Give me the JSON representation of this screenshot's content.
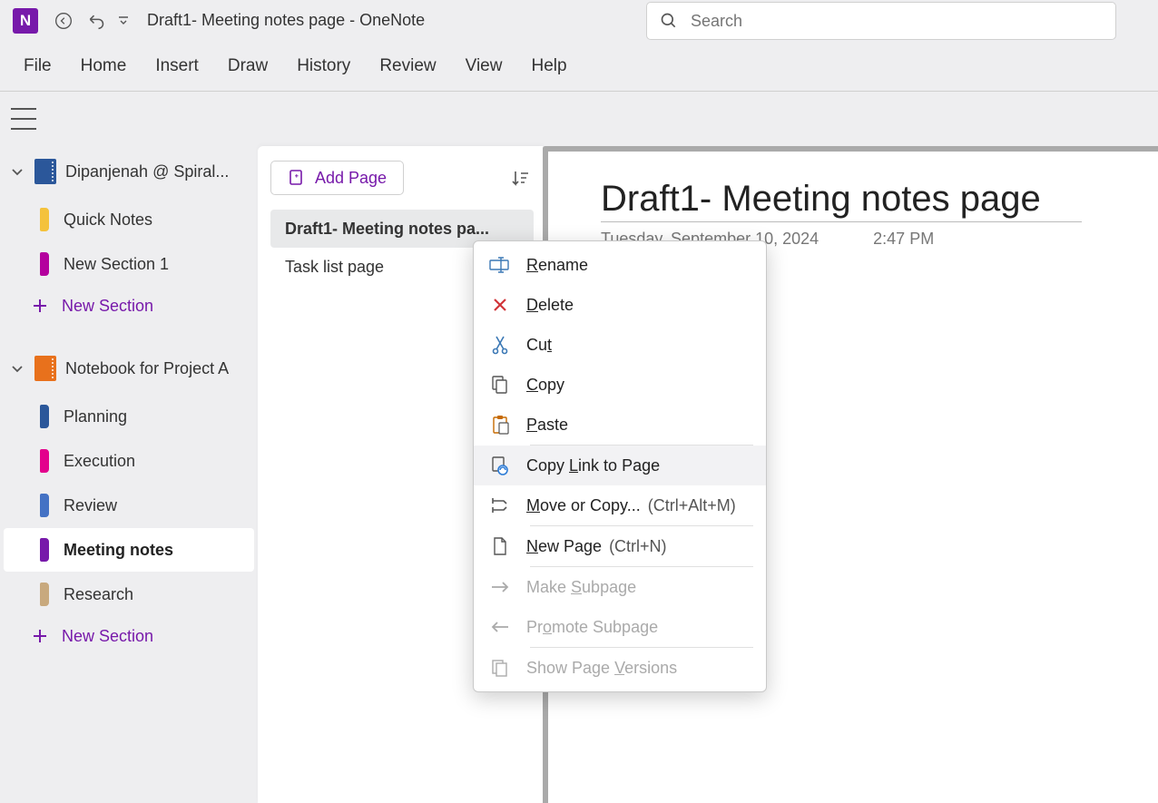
{
  "app": {
    "title": "Draft1- Meeting notes page  -  OneNote",
    "search_placeholder": "Search"
  },
  "ribbon": [
    "File",
    "Home",
    "Insert",
    "Draw",
    "History",
    "Review",
    "View",
    "Help"
  ],
  "notebooks": [
    {
      "name": "Dipanjenah @ Spiral...",
      "color": "#2b579a",
      "sections": [
        {
          "label": "Quick Notes",
          "color": "#f4c23c"
        },
        {
          "label": "New Section 1",
          "color": "#b4009e"
        }
      ]
    },
    {
      "name": "Notebook for Project A",
      "color": "#e8711c",
      "sections": [
        {
          "label": "Planning",
          "color": "#2b579a"
        },
        {
          "label": "Execution",
          "color": "#e3008c"
        },
        {
          "label": "Review",
          "color": "#4472c4"
        },
        {
          "label": "Meeting notes",
          "color": "#7719aa",
          "selected": true
        },
        {
          "label": "Research",
          "color": "#c8a97e"
        }
      ]
    }
  ],
  "new_section_label": "New Section",
  "pagelist": {
    "add_label": "Add Page",
    "pages": [
      {
        "label": "Draft1- Meeting notes pa...",
        "selected": true
      },
      {
        "label": "Task list page"
      }
    ]
  },
  "canvas": {
    "title": "Draft1- Meeting notes page",
    "date": "Tuesday, September 10, 2024",
    "time": "2:47 PM"
  },
  "ctx": {
    "items": [
      {
        "icon": "rename-icon",
        "label": "Rename",
        "ul": "R",
        "sep": false
      },
      {
        "icon": "delete-icon",
        "label": "Delete",
        "ul": "D",
        "color": "#d13438",
        "sep": false
      },
      {
        "icon": "cut-icon",
        "label": "Cut",
        "ul": "t",
        "sep": false
      },
      {
        "icon": "copy-icon",
        "label": "Copy",
        "ul": "C",
        "sep": false
      },
      {
        "icon": "paste-icon",
        "label": "Paste",
        "ul": "P",
        "sep": true
      },
      {
        "icon": "link-icon",
        "label": "Copy Link to Page",
        "ul": "L",
        "hover": true,
        "sep": false
      },
      {
        "icon": "move-icon",
        "label": "Move or Copy...",
        "ul": "M",
        "shortcut": "(Ctrl+Alt+M)",
        "sep": true
      },
      {
        "icon": "newpage-icon",
        "label": "New Page",
        "ul": "N",
        "shortcut": "(Ctrl+N)",
        "sep": true
      },
      {
        "icon": "right-arrow-icon",
        "label": "Make Subpage",
        "ul": "S",
        "disabled": true,
        "sep": false
      },
      {
        "icon": "left-arrow-icon",
        "label": "Promote Subpage",
        "ul": "o",
        "disabled": true,
        "sep": true
      },
      {
        "icon": "versions-icon",
        "label": "Show Page Versions",
        "ul": "V",
        "disabled": true,
        "sep": false
      }
    ]
  }
}
